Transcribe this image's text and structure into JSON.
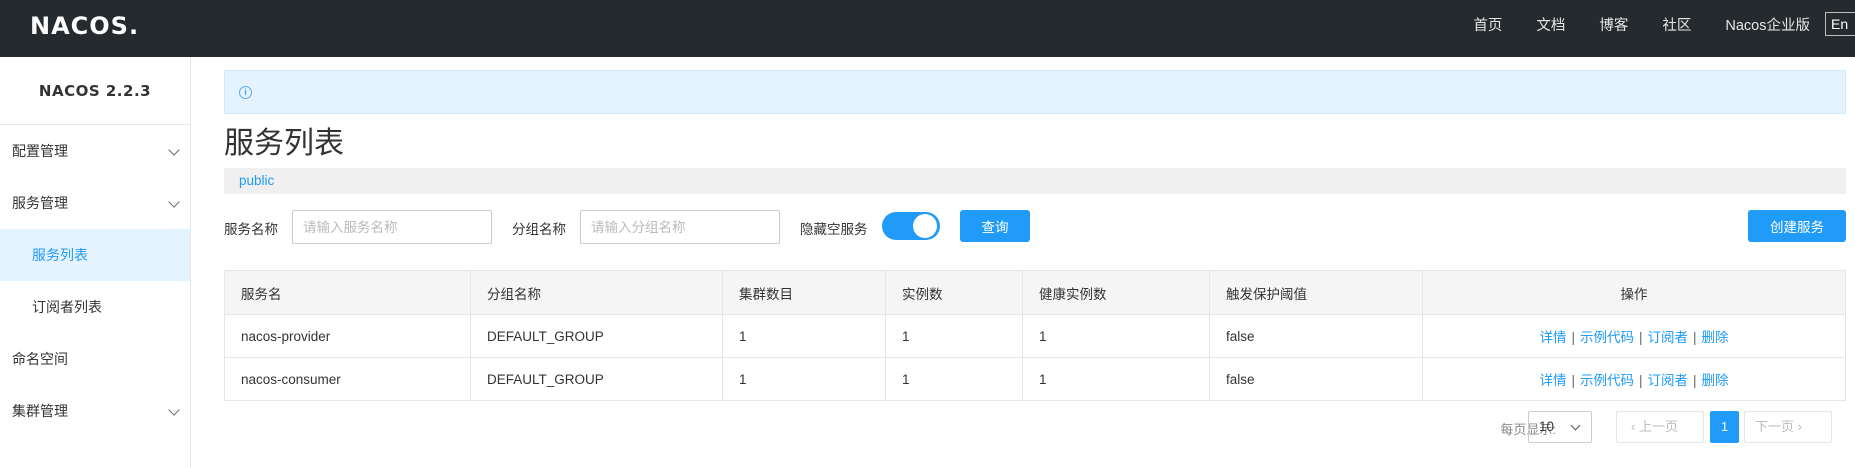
{
  "header": {
    "logo": "NACOS.",
    "nav": [
      "首页",
      "文档",
      "博客",
      "社区",
      "Nacos企业版"
    ],
    "lang_button": "En"
  },
  "sidebar": {
    "version": "NACOS 2.2.3",
    "items": [
      {
        "label": "配置管理",
        "expandable": true
      },
      {
        "label": "服务管理",
        "expandable": true
      },
      {
        "label": "服务列表",
        "sub": true,
        "active": true
      },
      {
        "label": "订阅者列表",
        "sub": true
      },
      {
        "label": "命名空间"
      },
      {
        "label": "集群管理",
        "expandable": true
      }
    ]
  },
  "main": {
    "title": "服务列表",
    "namespace": "public",
    "filters": {
      "service_name_label": "服务名称",
      "service_name_placeholder": "请输入服务名称",
      "group_name_label": "分组名称",
      "group_name_placeholder": "请输入分组名称",
      "hide_empty_label": "隐藏空服务",
      "hide_empty_on": true,
      "query_button": "查询",
      "create_button": "创建服务"
    },
    "table": {
      "columns": [
        "服务名",
        "分组名称",
        "集群数目",
        "实例数",
        "健康实例数",
        "触发保护阈值",
        "操作"
      ],
      "rows": [
        {
          "name": "nacos-provider",
          "group": "DEFAULT_GROUP",
          "clusters": "1",
          "instances": "1",
          "healthy": "1",
          "threshold": "false"
        },
        {
          "name": "nacos-consumer",
          "group": "DEFAULT_GROUP",
          "clusters": "1",
          "instances": "1",
          "healthy": "1",
          "threshold": "false"
        }
      ],
      "actions": [
        "详情",
        "示例代码",
        "订阅者",
        "删除"
      ]
    },
    "pagination": {
      "page_size_label": "每页显示:",
      "page_size": "10",
      "prev": "上一页",
      "current_page": "1",
      "next": "下一页"
    }
  },
  "colors": {
    "accent": "#209bfa",
    "topbar": "#252a2f",
    "notice_bg": "#e4f3fe"
  }
}
